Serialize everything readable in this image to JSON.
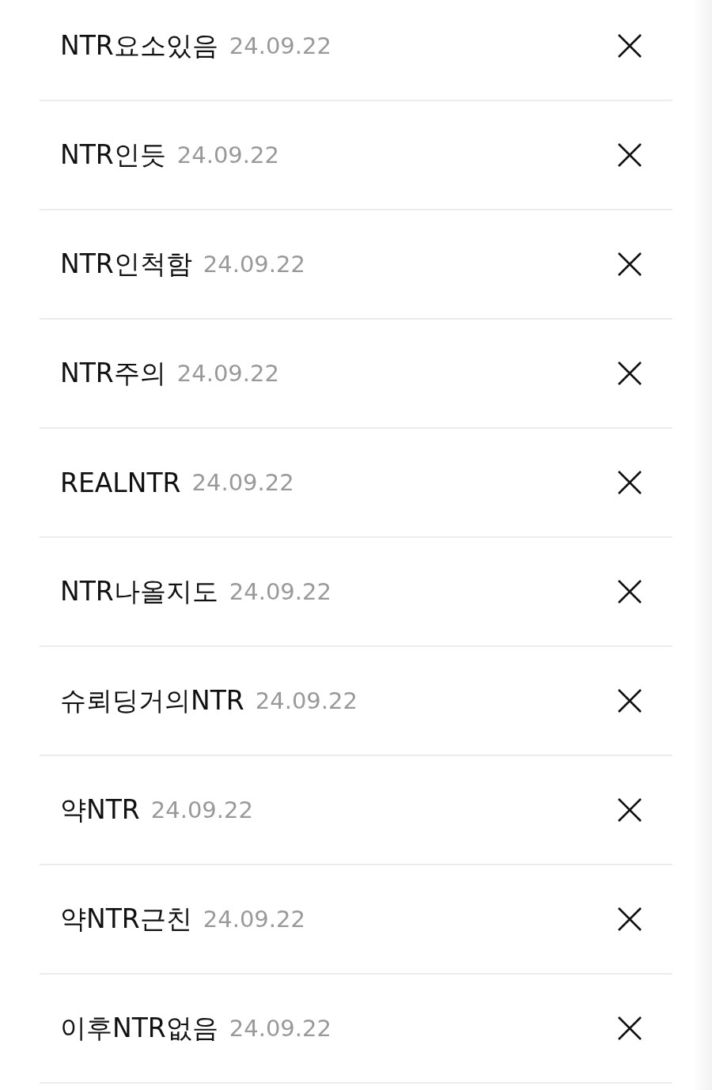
{
  "keywords": [
    {
      "label": "NTR요소있음",
      "date": "24.09.22"
    },
    {
      "label": "NTR인듯",
      "date": "24.09.22"
    },
    {
      "label": "NTR인척함",
      "date": "24.09.22"
    },
    {
      "label": "NTR주의",
      "date": "24.09.22"
    },
    {
      "label": "REALNTR",
      "date": "24.09.22"
    },
    {
      "label": "NTR나올지도",
      "date": "24.09.22"
    },
    {
      "label": "슈뢰딩거의NTR",
      "date": "24.09.22"
    },
    {
      "label": "약NTR",
      "date": "24.09.22"
    },
    {
      "label": "약NTR근친",
      "date": "24.09.22"
    },
    {
      "label": "이후NTR없음",
      "date": "24.09.22"
    }
  ]
}
